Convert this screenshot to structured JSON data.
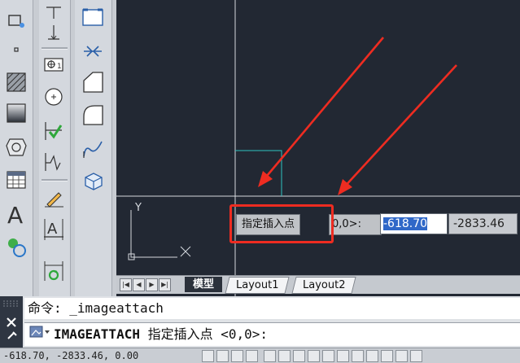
{
  "layout_tabs": {
    "model": "模型",
    "layout1": "Layout1",
    "layout2": "Layout2"
  },
  "dynamic_input": {
    "prompt_label": "指定插入点",
    "prompt_suffix": "0,0>:",
    "x_value": "-618.70",
    "y_value": "-2833.46"
  },
  "ucs": {
    "y_label": "Y"
  },
  "command_line": {
    "history": "命令: _imageattach",
    "command_name": "IMAGEATTACH",
    "command_prompt": " 指定插入点 <0,0>:"
  },
  "status_bar": {
    "coordinates": "-618.70, -2833.46, 0.00"
  },
  "colors": {
    "canvas_bg": "#222833",
    "annotation_red": "#ee2c21",
    "selection_blue": "#3068c8",
    "image_frame": "#2ec4c0"
  }
}
